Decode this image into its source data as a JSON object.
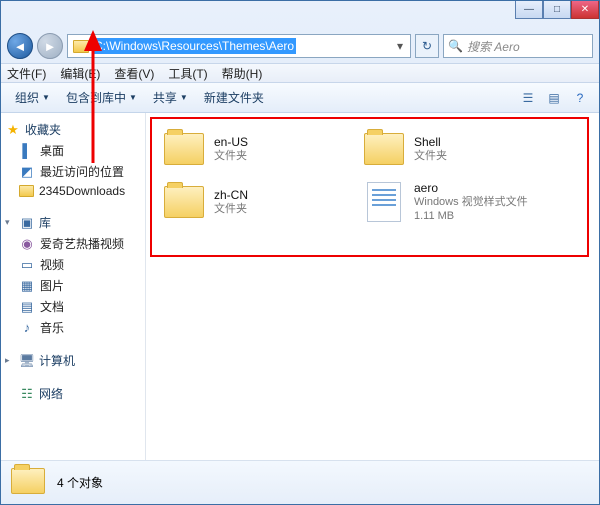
{
  "window": {
    "min": "—",
    "max": "□",
    "close": "✕"
  },
  "address": {
    "path": "C:\\Windows\\Resources\\Themes\\Aero"
  },
  "search": {
    "placeholder": "搜索 Aero"
  },
  "menu": {
    "file": "文件(F)",
    "edit": "编辑(E)",
    "view": "查看(V)",
    "tools": "工具(T)",
    "help": "帮助(H)"
  },
  "toolbar": {
    "organize": "组织",
    "include": "包含到库中",
    "share": "共享",
    "newfolder": "新建文件夹"
  },
  "sidebar": {
    "fav": "收藏夹",
    "fav_items": {
      "desktop": "桌面",
      "recent": "最近访问的位置",
      "downloads": "2345Downloads"
    },
    "lib": "库",
    "lib_items": {
      "iqiyi": "爱奇艺热播视频",
      "video": "视频",
      "pic": "图片",
      "doc": "文档",
      "music": "音乐"
    },
    "computer": "计算机",
    "network": "网络"
  },
  "items": [
    {
      "name": "en-US",
      "sub1": "文件夹",
      "sub2": "",
      "type": "folder"
    },
    {
      "name": "Shell",
      "sub1": "文件夹",
      "sub2": "",
      "type": "folder"
    },
    {
      "name": "zh-CN",
      "sub1": "文件夹",
      "sub2": "",
      "type": "folder"
    },
    {
      "name": "aero",
      "sub1": "Windows 视觉样式文件",
      "sub2": "1.11 MB",
      "type": "file"
    }
  ],
  "status": {
    "text": "4 个对象"
  }
}
